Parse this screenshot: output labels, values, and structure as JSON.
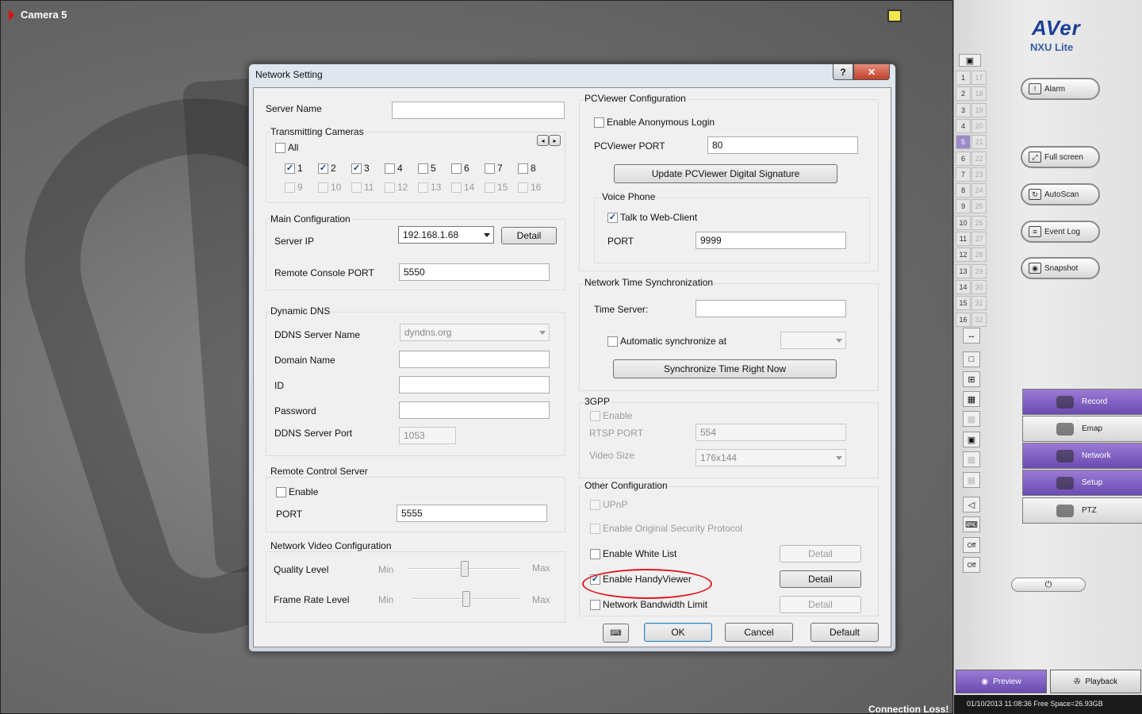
{
  "camera": {
    "title": "Camera 5",
    "status": "Connection Loss!"
  },
  "dialog": {
    "title": "Network Setting",
    "help": "?",
    "close": "✕",
    "server_name": {
      "label": "Server Name",
      "value": ""
    },
    "transmitting": {
      "title": "Transmitting Cameras",
      "all": "All",
      "cams": [
        {
          "n": "1",
          "checked": true
        },
        {
          "n": "2",
          "checked": true
        },
        {
          "n": "3",
          "checked": true
        },
        {
          "n": "4",
          "checked": false
        },
        {
          "n": "5",
          "checked": false
        },
        {
          "n": "6",
          "checked": false
        },
        {
          "n": "7",
          "checked": false
        },
        {
          "n": "8",
          "checked": false
        },
        {
          "n": "9",
          "checked": false
        },
        {
          "n": "10",
          "checked": false
        },
        {
          "n": "11",
          "checked": false
        },
        {
          "n": "12",
          "checked": false
        },
        {
          "n": "13",
          "checked": false
        },
        {
          "n": "14",
          "checked": false
        },
        {
          "n": "15",
          "checked": false
        },
        {
          "n": "16",
          "checked": false
        }
      ],
      "prev": "◂",
      "next": "▸"
    },
    "main": {
      "title": "Main Configuration",
      "server_ip_label": "Server IP",
      "server_ip": "192.168.1.68",
      "detail": "Detail",
      "rc_port_label": "Remote Console PORT",
      "rc_port": "5550"
    },
    "ddns": {
      "title": "Dynamic DNS",
      "server_name_label": "DDNS Server Name",
      "server_name": "dyndns.org",
      "domain_label": "Domain Name",
      "id_label": "ID",
      "password_label": "Password",
      "port_label": "DDNS Server Port",
      "port": "1053"
    },
    "rcs": {
      "title": "Remote Control Server",
      "enable": "Enable",
      "port_label": "PORT",
      "port": "5555"
    },
    "nvc": {
      "title": "Network Video Configuration",
      "quality": "Quality Level",
      "frame": "Frame Rate Level",
      "min": "Min",
      "max": "Max",
      "quality_level": 0.5,
      "frame_level": 0.5
    },
    "pcv": {
      "title": "PCViewer Configuration",
      "anon": "Enable Anonymous Login",
      "port_label": "PCViewer PORT",
      "port": "80",
      "update": "Update PCViewer Digital Signature",
      "voice": {
        "title": "Voice Phone",
        "talk": "Talk to Web-Client",
        "port_label": "PORT",
        "port": "9999"
      }
    },
    "nts": {
      "title": "Network Time Synchronization",
      "server_label": "Time Server:",
      "server": "",
      "auto": "Automatic synchronize at",
      "sync": "Synchronize Time Right Now"
    },
    "gpp": {
      "title": "3GPP",
      "enable": "Enable",
      "rtsp_label": "RTSP PORT",
      "rtsp": "554",
      "size_label": "Video Size",
      "size": "176x144"
    },
    "other": {
      "title": "Other Configuration",
      "upnp": "UPnP",
      "orig": "Enable Original Security Protocol",
      "white": "Enable White List",
      "handy": "Enable HandyViewer",
      "bw": "Network Bandwidth Limit",
      "detail": "Detail"
    },
    "footer": {
      "ok": "OK",
      "cancel": "Cancel",
      "default": "Default"
    }
  },
  "panel": {
    "logo": "AVer",
    "product": "NXU Lite",
    "channels_left": [
      "1",
      "2",
      "3",
      "4",
      "5",
      "6",
      "7",
      "8",
      "9",
      "10",
      "11",
      "12",
      "13",
      "14",
      "15",
      "16"
    ],
    "channels_right": [
      "17",
      "18",
      "19",
      "20",
      "21",
      "22",
      "23",
      "24",
      "25",
      "26",
      "27",
      "28",
      "29",
      "30",
      "31",
      "32"
    ],
    "selected_channel": "5",
    "buttons": {
      "alarm": "Alarm",
      "fullscreen": "Full screen",
      "autoscan": "AutoScan",
      "eventlog": "Event Log",
      "snapshot": "Snapshot"
    },
    "menu": {
      "record": "Record",
      "emap": "Emap",
      "network": "Network",
      "setup": "Setup",
      "ptz": "PTZ"
    },
    "tools": {
      "off1": "Off",
      "off2": "Off"
    },
    "power": "⏻",
    "tabs": {
      "preview": "Preview",
      "playback": "Playback"
    },
    "status": "01/10/2013 11:08:36  Free Space=26.93GB"
  }
}
